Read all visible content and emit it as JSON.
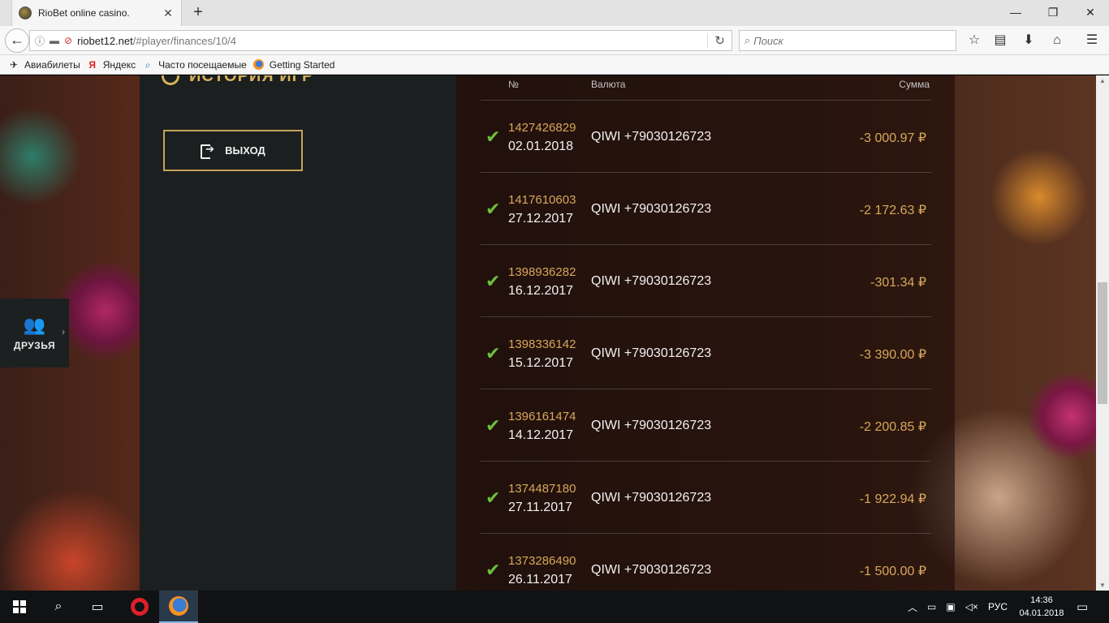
{
  "browser": {
    "tab_title": "RioBet online casino.",
    "url_host": "riobet12.net",
    "url_path": "/#player/finances/10/4",
    "search_placeholder": "Поиск"
  },
  "bookmarks": [
    {
      "label": "Авиабилеты",
      "icon": "plane-icon"
    },
    {
      "label": "Яндекс",
      "icon": "yandex-icon"
    },
    {
      "label": "Часто посещаемые",
      "icon": "frequent-icon"
    },
    {
      "label": "Getting Started",
      "icon": "firefox-icon"
    }
  ],
  "sidebar": {
    "section_title": "ИСТОРИЯ ИГР",
    "exit_label": "ВЫХОД",
    "friends_label": "ДРУЗЬЯ"
  },
  "table": {
    "headers": {
      "num": "№",
      "currency": "Валюта",
      "sum": "Сумма"
    },
    "rows": [
      {
        "num": "1427426829",
        "date": "02.01.2018",
        "currency": "QIWI +79030126723",
        "amount": "-3 000.97 ₽"
      },
      {
        "num": "1417610603",
        "date": "27.12.2017",
        "currency": "QIWI +79030126723",
        "amount": "-2 172.63 ₽"
      },
      {
        "num": "1398936282",
        "date": "16.12.2017",
        "currency": "QIWI +79030126723",
        "amount": "-301.34 ₽"
      },
      {
        "num": "1398336142",
        "date": "15.12.2017",
        "currency": "QIWI +79030126723",
        "amount": "-3 390.00 ₽"
      },
      {
        "num": "1396161474",
        "date": "14.12.2017",
        "currency": "QIWI +79030126723",
        "amount": "-2 200.85 ₽"
      },
      {
        "num": "1374487180",
        "date": "27.11.2017",
        "currency": "QIWI +79030126723",
        "amount": "-1 922.94 ₽"
      },
      {
        "num": "1373286490",
        "date": "26.11.2017",
        "currency": "QIWI +79030126723",
        "amount": "-1 500.00 ₽"
      }
    ]
  },
  "taskbar": {
    "language": "РУС",
    "time": "14:36",
    "date": "04.01.2018"
  },
  "colors": {
    "accent_gold": "#d8a85a",
    "success_green": "#6cbf3c",
    "panel_dark": "#1b1f1f"
  }
}
